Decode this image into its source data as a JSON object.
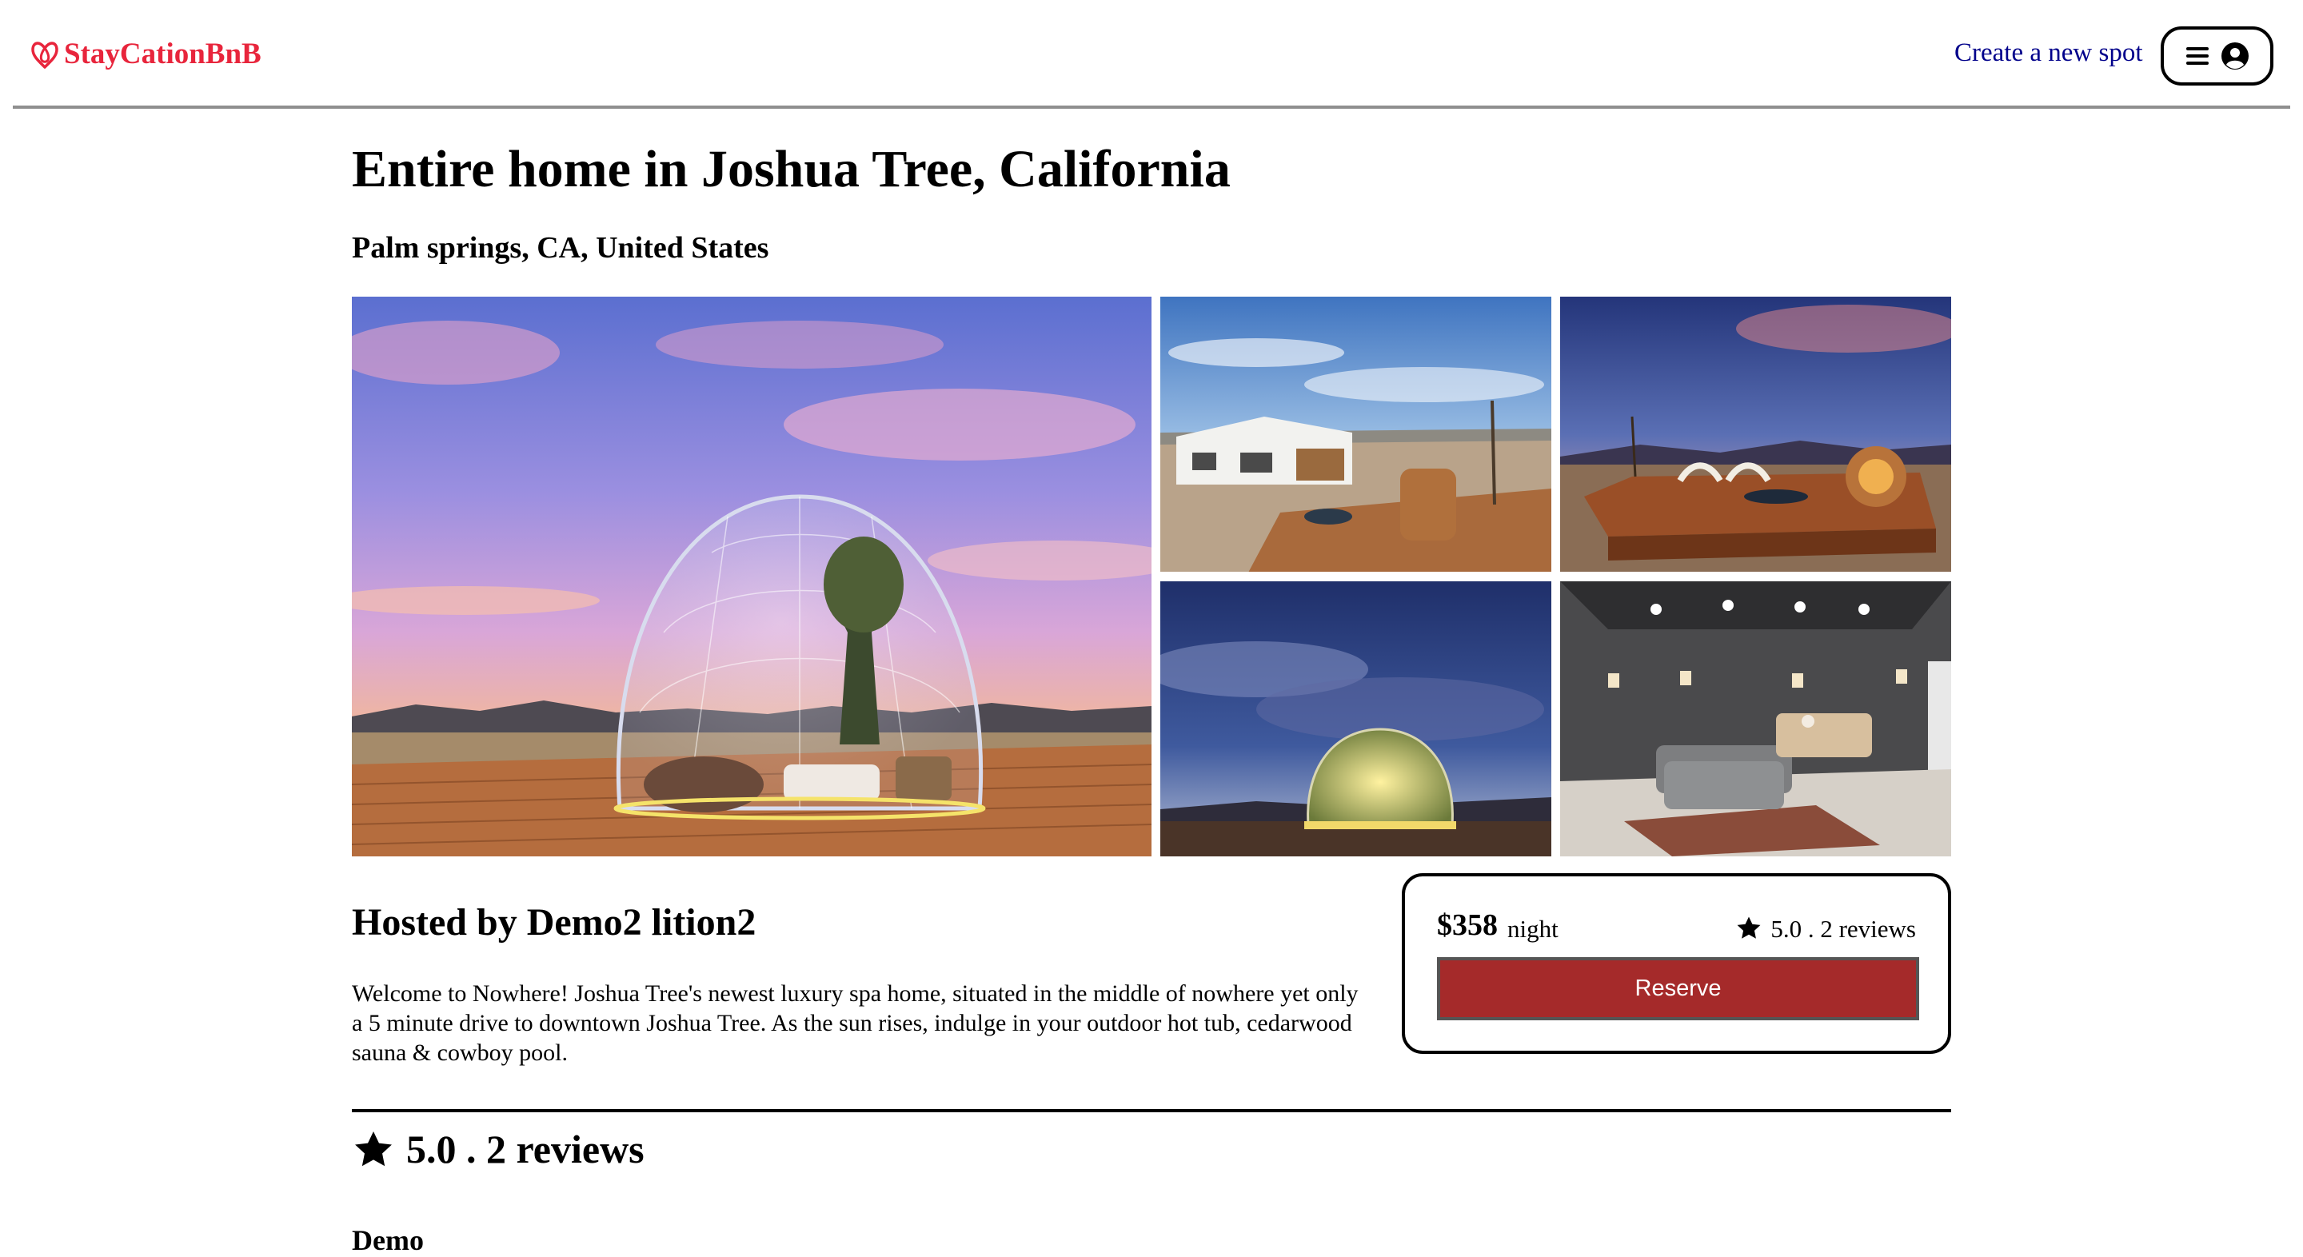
{
  "header": {
    "logo_text": "StayCationBnB",
    "create_spot_label": "Create a new spot",
    "menu_icon": "hamburger-icon",
    "profile_icon": "user-circle-icon"
  },
  "colors": {
    "brand": "#e8253c",
    "link": "#00008b",
    "reserve_button": "#a52a2a"
  },
  "spot": {
    "title": "Entire home in Joshua Tree, California",
    "location": "Palm springs, CA, United States",
    "host": "Hosted by Demo2 lition2",
    "description": "Welcome to Nowhere! Joshua Tree's newest luxury spa home, situated in the middle of nowhere yet only a 5 minute drive to downtown Joshua Tree. As the sun rises, indulge in your outdoor hot tub, cedarwood sauna & cowboy pool.",
    "images": [
      {
        "subject": "geodesic glass dome at sunset on a wooden deck"
      },
      {
        "subject": "desert house with wooden deck, hot tub and barrel sauna"
      },
      {
        "subject": "deck with hammocks and barrel sauna at dusk"
      },
      {
        "subject": "illuminated dome under a dramatic evening sky"
      },
      {
        "subject": "grey home theater room with sectional sofa"
      }
    ]
  },
  "booking": {
    "price": "$358",
    "unit": "night",
    "rating_text": "5.0 . 2 reviews",
    "reserve_label": "Reserve",
    "star_icon": "star-icon"
  },
  "reviews": {
    "heading": "5.0 . 2 reviews",
    "items": [
      {
        "author": "Demo"
      }
    ]
  }
}
